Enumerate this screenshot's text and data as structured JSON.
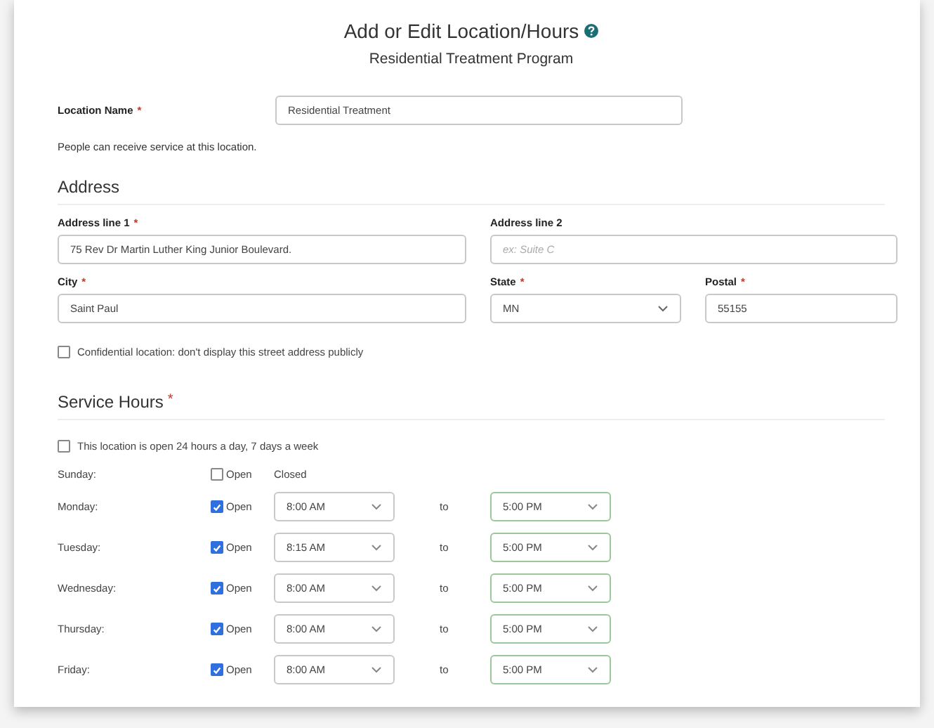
{
  "header": {
    "title": "Add or Edit Location/Hours",
    "subtitle": "Residential Treatment Program"
  },
  "required_marker": "*",
  "location": {
    "label": "Location Name",
    "required": true,
    "value": "Residential Treatment",
    "help": "People can receive service at this location."
  },
  "address": {
    "heading": "Address",
    "fields": [
      {
        "label": "Address line 1",
        "required": true,
        "kind": "text",
        "value": "75 Rev Dr Martin Luther King Junior Boulevard."
      },
      {
        "label": "Address line 2",
        "required": false,
        "kind": "text",
        "placeholder": "ex: Suite C"
      },
      {
        "label": "City",
        "required": true,
        "kind": "text",
        "value": "Saint Paul"
      },
      {
        "label": "State",
        "required": true,
        "kind": "select",
        "value": "MN"
      },
      {
        "label": "Postal",
        "required": true,
        "kind": "text",
        "value": "55155"
      }
    ],
    "confidential": {
      "label": "Confidential location: don't display this street address publicly",
      "checked": false
    }
  },
  "hours": {
    "heading": "Service Hours",
    "required": true,
    "always_open": {
      "label": "This location is open 24 hours a day, 7 days a week",
      "checked": false
    },
    "days": [
      {
        "day": "Sunday:",
        "open": false,
        "open_label": "Open",
        "status": "Closed"
      },
      {
        "day": "Monday:",
        "open": true,
        "open_label": "Open",
        "start": "8:00 AM",
        "to": "to",
        "end": "5:00 PM"
      },
      {
        "day": "Tuesday:",
        "open": true,
        "open_label": "Open",
        "start": "8:15 AM",
        "to": "to",
        "end": "5:00 PM"
      },
      {
        "day": "Wednesday:",
        "open": true,
        "open_label": "Open",
        "start": "8:00 AM",
        "to": "to",
        "end": "5:00 PM"
      },
      {
        "day": "Thursday:",
        "open": true,
        "open_label": "Open",
        "start": "8:00 AM",
        "to": "to",
        "end": "5:00 PM"
      },
      {
        "day": "Friday:",
        "open": true,
        "open_label": "Open",
        "start": "8:00 AM",
        "to": "to",
        "end": "5:00 PM"
      }
    ]
  }
}
